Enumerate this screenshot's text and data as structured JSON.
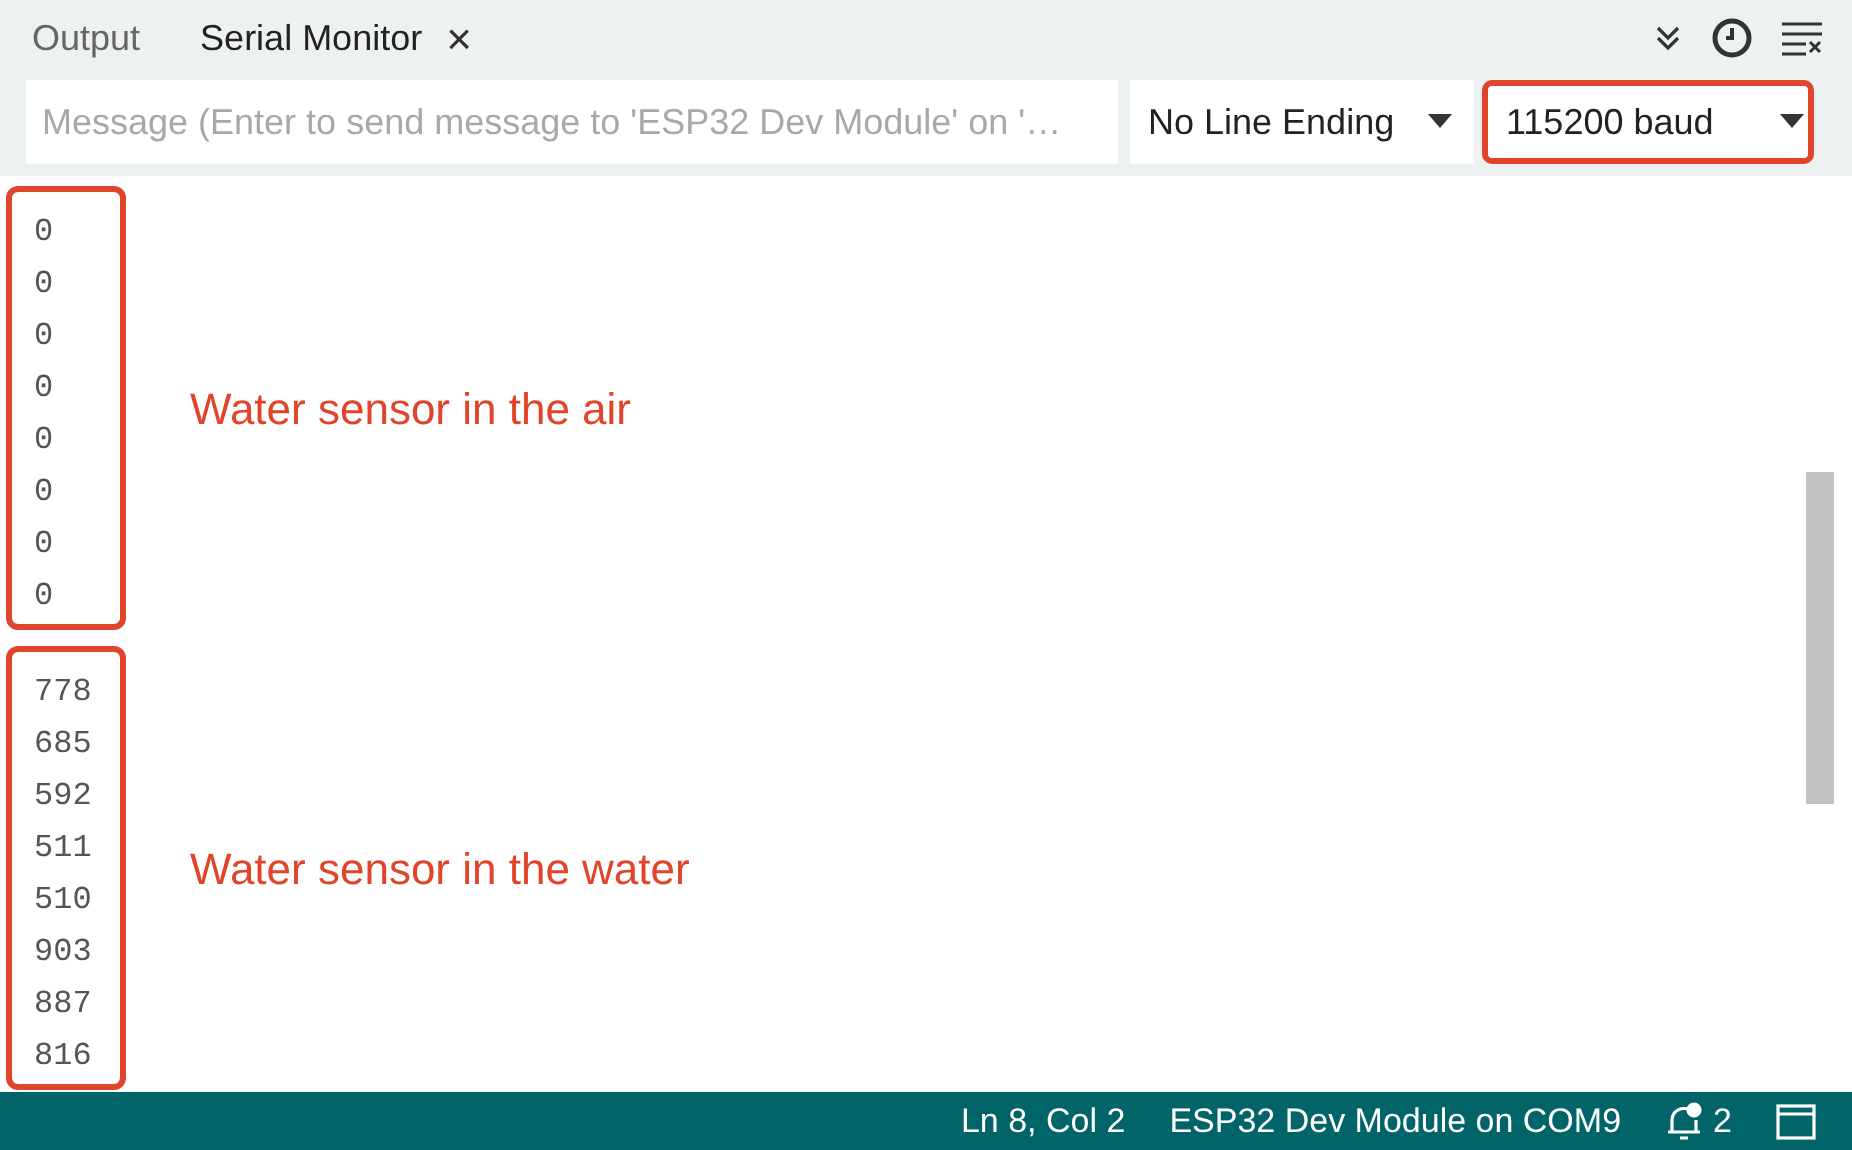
{
  "tabs": [
    {
      "label": "Output",
      "selected": false
    },
    {
      "label": "Serial Monitor",
      "selected": true,
      "close": "×"
    }
  ],
  "message_field": {
    "placeholder": "Message (Enter to send message to 'ESP32 Dev Module' on '…"
  },
  "dropdowns": [
    {
      "value": "No Line Ending",
      "highlighted": false
    },
    {
      "value": "115200 baud",
      "highlighted": true
    }
  ],
  "output_groups": [
    {
      "lines": [
        "0",
        "0",
        "0",
        "0",
        "0",
        "0",
        "0",
        "0"
      ],
      "note": "Water sensor in the air"
    },
    {
      "lines": [
        "778",
        "685",
        "592",
        "511",
        "510",
        "903",
        "887",
        "816"
      ],
      "note": "Water sensor in the water"
    }
  ],
  "status_bar": {
    "position": "Ln 8, Col 2",
    "board": "ESP32 Dev Module on COM9",
    "notifications": "2"
  }
}
